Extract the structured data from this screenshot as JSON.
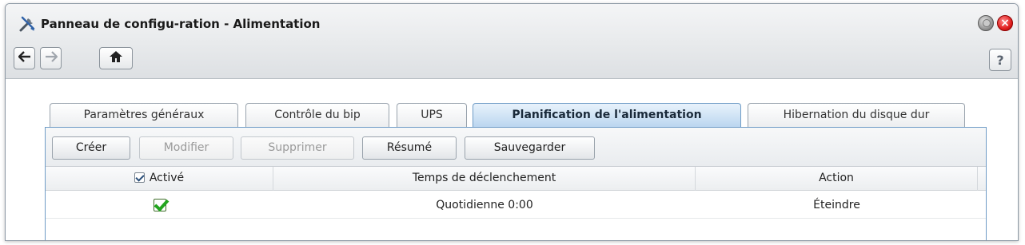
{
  "window": {
    "title": "Panneau de configu-ration - Alimentation",
    "help_label": "?"
  },
  "tabs": [
    {
      "label": "Paramètres généraux",
      "active": false
    },
    {
      "label": "Contrôle du bip",
      "active": false
    },
    {
      "label": "UPS",
      "active": false
    },
    {
      "label": "Planification de l'alimentation",
      "active": true
    },
    {
      "label": "Hibernation du disque dur",
      "active": false
    }
  ],
  "toolbar": {
    "create": "Créer",
    "modify": "Modifier",
    "delete": "Supprimer",
    "summary": "Résumé",
    "save": "Sauvegarder"
  },
  "table": {
    "columns": [
      "Activé",
      "Temps de déclenchement",
      "Action"
    ],
    "header_checkbox_checked": true,
    "rows": [
      {
        "enabled": true,
        "trigger": "Quotidienne 0:00",
        "action": "Éteindre"
      }
    ]
  },
  "icons": {
    "app": "tools-icon",
    "back": "arrow-left-icon",
    "forward": "arrow-right-icon",
    "home": "home-icon",
    "minimize": "minimize-icon",
    "close": "close-icon"
  },
  "colors": {
    "active_tab_border": "#6f9cc6",
    "check_green": "#22a51f",
    "close_red": "#e02020"
  }
}
